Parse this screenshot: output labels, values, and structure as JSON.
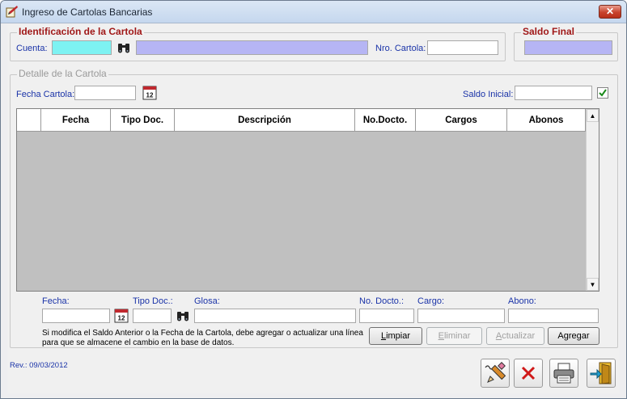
{
  "window": {
    "title": "Ingreso de Cartolas Bancarias",
    "close_glyph": "✕"
  },
  "identificacion": {
    "title": "Identificación de la Cartola",
    "cuenta_label": "Cuenta:",
    "cuenta_value": "",
    "cuenta_desc_value": "",
    "search_icon": "binoculars-icon",
    "nro_cartola_label": "Nro. Cartola:",
    "nro_cartola_value": ""
  },
  "saldo_final": {
    "title": "Saldo Final",
    "value": ""
  },
  "detalle": {
    "title": "Detalle de la Cartola",
    "fecha_cartola_label": "Fecha Cartola:",
    "fecha_cartola_value": "",
    "calendar_icon": "calendar-icon",
    "saldo_inicial_label": "Saldo Inicial:",
    "saldo_inicial_value": "",
    "saldo_inicial_checked": true
  },
  "grid": {
    "columns": [
      "",
      "Fecha",
      "Tipo Doc.",
      "Descripción",
      "No.Docto.",
      "Cargos",
      "Abonos"
    ],
    "rows": []
  },
  "entry": {
    "fecha_label": "Fecha:",
    "tipo_doc_label": "Tipo Doc.:",
    "glosa_label": "Glosa:",
    "no_docto_label": "No. Docto.:",
    "cargo_label": "Cargo:",
    "abono_label": "Abono:",
    "fecha_value": "",
    "tipo_doc_value": "",
    "glosa_value": "",
    "no_docto_value": "",
    "cargo_value": "",
    "abono_value": ""
  },
  "note": {
    "line1": "Si modifica el Saldo Anterior o la Fecha de la Cartola, debe agregar o actualizar una línea",
    "line2": "para que se almacene el cambio en la base de datos."
  },
  "buttons": {
    "limpiar": {
      "prefix": "",
      "accel": "L",
      "rest": "impiar"
    },
    "eliminar": {
      "prefix": "",
      "accel": "E",
      "rest": "liminar"
    },
    "actualizar": {
      "prefix": "",
      "accel": "A",
      "rest": "ctualizar"
    },
    "agregar": {
      "prefix": "A",
      "accel": "g",
      "rest": "regar"
    }
  },
  "toolbar": {
    "edit_icon": "pencil-edit-icon",
    "cancel_icon": "red-x-icon",
    "print_icon": "printer-icon",
    "exit_icon": "exit-door-icon"
  },
  "revision": "Rev.: 09/03/2012",
  "colors": {
    "label_blue": "#1a33a8",
    "group_title_red": "#a01818",
    "cuenta_input": "#7df2f2",
    "lavender_input": "#b6b5f4",
    "grid_body": "#c0c0c0"
  }
}
